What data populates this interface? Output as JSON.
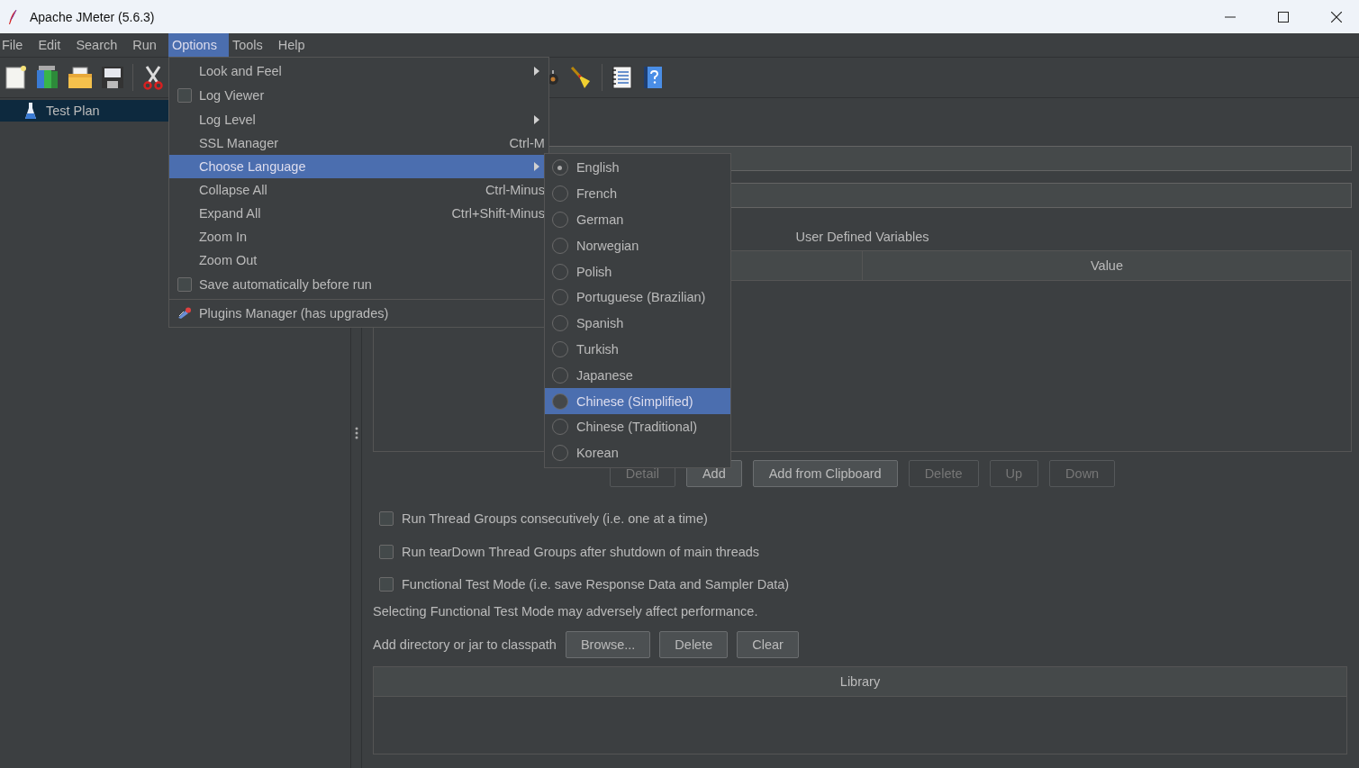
{
  "window": {
    "title": "Apache JMeter (5.6.3)"
  },
  "menubar": [
    {
      "label": "File",
      "selected": false
    },
    {
      "label": "Edit",
      "selected": false
    },
    {
      "label": "Search",
      "selected": false
    },
    {
      "label": "Run",
      "selected": false
    },
    {
      "label": "Options",
      "selected": true
    },
    {
      "label": "Tools",
      "selected": false
    },
    {
      "label": "Help",
      "selected": false
    }
  ],
  "options_menu": [
    {
      "kind": "submenu",
      "label": "Look and Feel",
      "selected": false
    },
    {
      "kind": "check",
      "label": "Log Viewer",
      "checked": false,
      "selected": false
    },
    {
      "kind": "submenu",
      "label": "Log Level",
      "selected": false
    },
    {
      "kind": "item",
      "label": "SSL Manager",
      "shortcut": "Ctrl-M",
      "selected": false
    },
    {
      "kind": "submenu",
      "label": "Choose Language",
      "selected": true
    },
    {
      "kind": "item",
      "label": "Collapse All",
      "shortcut": "Ctrl-Minus",
      "selected": false
    },
    {
      "kind": "item",
      "label": "Expand All",
      "shortcut": "Ctrl+Shift-Minus",
      "selected": false
    },
    {
      "kind": "item",
      "label": "Zoom In",
      "selected": false
    },
    {
      "kind": "item",
      "label": "Zoom Out",
      "selected": false
    },
    {
      "kind": "check",
      "label": "Save automatically before run",
      "checked": false,
      "selected": false
    },
    {
      "kind": "separator"
    },
    {
      "kind": "plugin",
      "label": "Plugins Manager (has upgrades)",
      "selected": false
    }
  ],
  "language_menu": [
    {
      "label": "English",
      "checked": true,
      "selected": false
    },
    {
      "label": "French",
      "checked": false,
      "selected": false
    },
    {
      "label": "German",
      "checked": false,
      "selected": false
    },
    {
      "label": "Norwegian",
      "checked": false,
      "selected": false
    },
    {
      "label": "Polish",
      "checked": false,
      "selected": false
    },
    {
      "label": "Portuguese (Brazilian)",
      "checked": false,
      "selected": false
    },
    {
      "label": "Spanish",
      "checked": false,
      "selected": false
    },
    {
      "label": "Turkish",
      "checked": false,
      "selected": false
    },
    {
      "label": "Japanese",
      "checked": false,
      "selected": false
    },
    {
      "label": "Chinese (Simplified)",
      "checked": false,
      "selected": true
    },
    {
      "label": "Chinese (Traditional)",
      "checked": false,
      "selected": false
    },
    {
      "label": "Korean",
      "checked": false,
      "selected": false
    }
  ],
  "tree": [
    {
      "label": "Test Plan",
      "selected": true
    }
  ],
  "variables": {
    "title": "User Defined Variables",
    "column_2": "Value",
    "buttons": [
      {
        "label": "Detail",
        "disabled": true
      },
      {
        "label": "Add",
        "disabled": false
      },
      {
        "label": "Add from Clipboard",
        "disabled": false
      },
      {
        "label": "Delete",
        "disabled": true
      },
      {
        "label": "Up",
        "disabled": true
      },
      {
        "label": "Down",
        "disabled": true
      }
    ]
  },
  "options": [
    {
      "label": "Run Thread Groups consecutively (i.e. one at a time)",
      "checked": false
    },
    {
      "label": "Run tearDown Thread Groups after shutdown of main threads",
      "checked": false
    },
    {
      "label": "Functional Test Mode (i.e. save Response Data and Sampler Data)",
      "checked": false
    }
  ],
  "note": "Selecting Functional Test Mode may adversely affect performance.",
  "classpath": {
    "label": "Add directory or jar to classpath",
    "buttons": [
      "Browse...",
      "Delete",
      "Clear"
    ],
    "column": "Library"
  }
}
